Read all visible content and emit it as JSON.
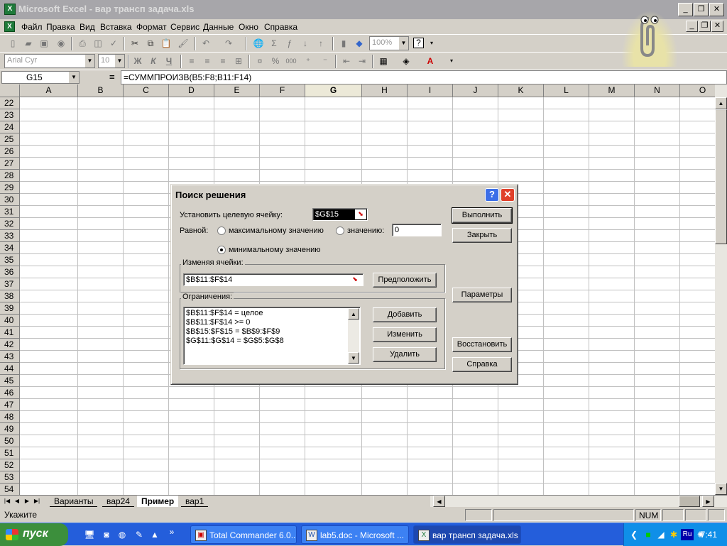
{
  "window": {
    "title": "Microsoft Excel - вар трансп задача.xls",
    "app_icon_label": "X"
  },
  "menu": [
    {
      "label": "Файл"
    },
    {
      "label": "Правка"
    },
    {
      "label": "Вид"
    },
    {
      "label": "Вставка"
    },
    {
      "label": "Формат"
    },
    {
      "label": "Сервис"
    },
    {
      "label": "Данные"
    },
    {
      "label": "Окно"
    },
    {
      "label": "Справка"
    }
  ],
  "toolbar": {
    "zoom": "100%",
    "font_name": "Arial Cyr",
    "font_size": "10",
    "bold": "Ж",
    "italic": "К",
    "underline": "Ч",
    "percent": "%",
    "thousands": "000"
  },
  "formula_bar": {
    "name_box": "G15",
    "equals": "=",
    "formula": "=СУММПРОИЗВ(B5:F8;B11:F14)"
  },
  "grid": {
    "columns": [
      "A",
      "B",
      "C",
      "D",
      "E",
      "F",
      "G",
      "H",
      "I",
      "J",
      "K",
      "L",
      "M",
      "N",
      "O"
    ],
    "selected_column": "G",
    "rows": [
      "22",
      "23",
      "24",
      "25",
      "26",
      "27",
      "28",
      "29",
      "30",
      "31",
      "32",
      "33",
      "34",
      "35",
      "36",
      "37",
      "38",
      "39",
      "40",
      "41",
      "42",
      "43",
      "44",
      "45",
      "46",
      "47",
      "48",
      "49",
      "50",
      "51",
      "52",
      "53",
      "54"
    ]
  },
  "sheet_tabs": [
    {
      "label": "Варианты"
    },
    {
      "label": "вар24"
    },
    {
      "label": "Пример"
    },
    {
      "label": "вар1"
    }
  ],
  "active_sheet": "Пример",
  "status": {
    "mode": "Укажите",
    "num": "NUM"
  },
  "dialog": {
    "title": "Поиск решения",
    "help_glyph": "?",
    "close_glyph": "✕",
    "target_label": "Установить целевую ячейку:",
    "target_value": "$G$15",
    "equal_label": "Равной:",
    "opt_max": "максимальному значению",
    "opt_value": "значению:",
    "opt_value_input": "0",
    "opt_min": "минимальному значению",
    "changing_label": "Изменяя ячейки:",
    "changing_value": "$B$11:$F$14",
    "guess_button": "Предположить",
    "constraints_label": "Ограничения:",
    "constraints": [
      "$B$11:$F$14 = целое",
      "$B$11:$F$14 >= 0",
      "$B$15:$F$15 = $B$9:$F$9",
      "$G$11:$G$14 = $G$5:$G$8"
    ],
    "buttons": {
      "solve": "Выполнить",
      "close": "Закрыть",
      "options": "Параметры",
      "add": "Добавить",
      "change": "Изменить",
      "delete": "Удалить",
      "reset": "Восстановить",
      "help": "Справка"
    }
  },
  "taskbar": {
    "start": "пуск",
    "tasks": [
      {
        "label": "Total Commander 6.0..."
      },
      {
        "label": "lab5.doc - Microsoft ..."
      },
      {
        "label": "вар трансп задача.xls"
      }
    ],
    "tray_lang": "Ru",
    "clock": "7:41"
  },
  "colors": {
    "title_inactive": "#a7a6aa",
    "taskbar": "#245edb",
    "start_green": "#3c8f3c",
    "dialog_close_red": "#e0402a"
  }
}
